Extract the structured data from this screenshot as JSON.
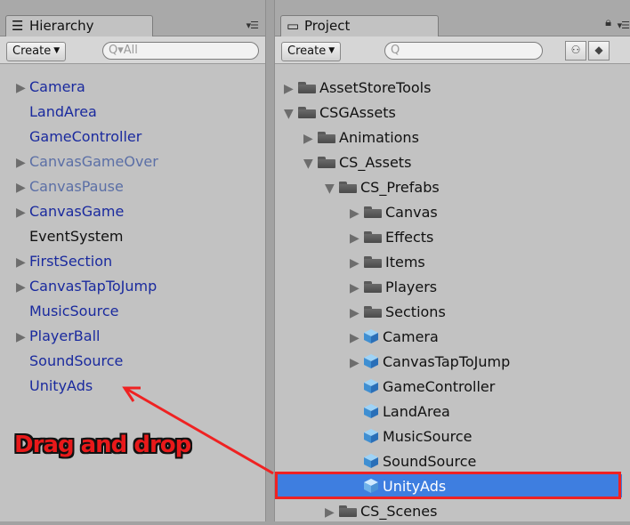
{
  "hierarchy": {
    "tab_label": "Hierarchy",
    "create_label": "Create",
    "search_placeholder": "All",
    "items": [
      {
        "label": "Camera"
      },
      {
        "label": "LandArea"
      },
      {
        "label": "GameController"
      },
      {
        "label": "CanvasGameOver"
      },
      {
        "label": "CanvasPause"
      },
      {
        "label": "CanvasGame"
      },
      {
        "label": "EventSystem"
      },
      {
        "label": "FirstSection"
      },
      {
        "label": "CanvasTapToJump"
      },
      {
        "label": "MusicSource"
      },
      {
        "label": "PlayerBall"
      },
      {
        "label": "SoundSource"
      },
      {
        "label": "UnityAds"
      }
    ]
  },
  "project": {
    "tab_label": "Project",
    "create_label": "Create",
    "search_placeholder": "",
    "items": [
      {
        "label": "AssetStoreTools",
        "icon": "folder-icon"
      },
      {
        "label": "CSGAssets",
        "icon": "folder-icon"
      },
      {
        "label": "Animations",
        "icon": "folder-icon"
      },
      {
        "label": "CS_Assets",
        "icon": "folder-icon"
      },
      {
        "label": "CS_Prefabs",
        "icon": "folder-icon"
      },
      {
        "label": "Canvas",
        "icon": "folder-icon"
      },
      {
        "label": "Effects",
        "icon": "folder-icon"
      },
      {
        "label": "Items",
        "icon": "folder-icon"
      },
      {
        "label": "Players",
        "icon": "folder-icon"
      },
      {
        "label": "Sections",
        "icon": "folder-icon"
      },
      {
        "label": "Camera",
        "icon": "prefab-cube-icon"
      },
      {
        "label": "CanvasTapToJump",
        "icon": "prefab-cube-icon"
      },
      {
        "label": "GameController",
        "icon": "prefab-cube-icon"
      },
      {
        "label": "LandArea",
        "icon": "prefab-cube-icon"
      },
      {
        "label": "MusicSource",
        "icon": "prefab-cube-icon"
      },
      {
        "label": "SoundSource",
        "icon": "prefab-cube-icon"
      },
      {
        "label": "UnityAds",
        "icon": "prefab-cube-icon"
      },
      {
        "label": "CS_Scenes",
        "icon": "folder-icon"
      }
    ]
  },
  "annotation": {
    "text": "Drag and drop",
    "color": "#e8191a"
  },
  "colors": {
    "selection": "#3e7ee0",
    "scene_text": "#1a2a9e"
  }
}
